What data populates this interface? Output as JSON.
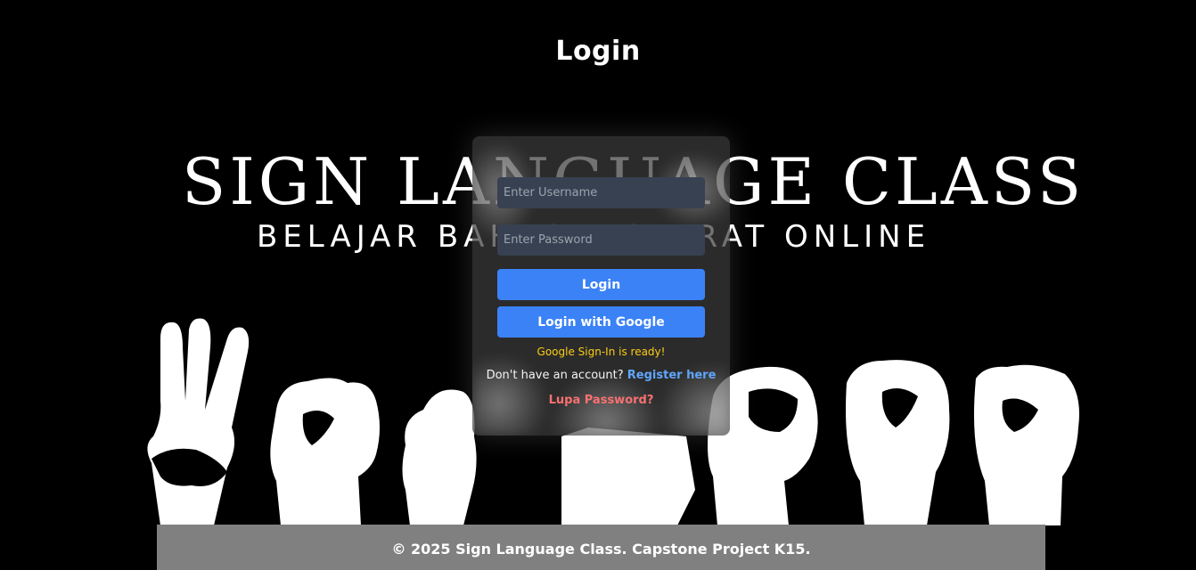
{
  "header": {
    "title": "Login"
  },
  "hero": {
    "heading": "SIGN LANGUAGE CLASS",
    "subheading": "BELAJAR BAHASA ISYARAT ONLINE"
  },
  "form": {
    "username_placeholder": "Enter Username",
    "password_placeholder": "Enter Password",
    "login_label": "Login",
    "google_label": "Login with Google",
    "status": "Google Sign-In is ready!",
    "register_prompt": "Don't have an account?",
    "register_link": "Register here",
    "forgot_link": "Lupa Password?"
  },
  "footer": {
    "text": "© 2025 Sign Language Class. Capstone Project K15."
  },
  "colors": {
    "background": "#000000",
    "primary_button": "#3b82f6",
    "status": "#facc15",
    "link": "#60a5fa",
    "forgot": "#f87171",
    "footer_bg": "#808080"
  }
}
